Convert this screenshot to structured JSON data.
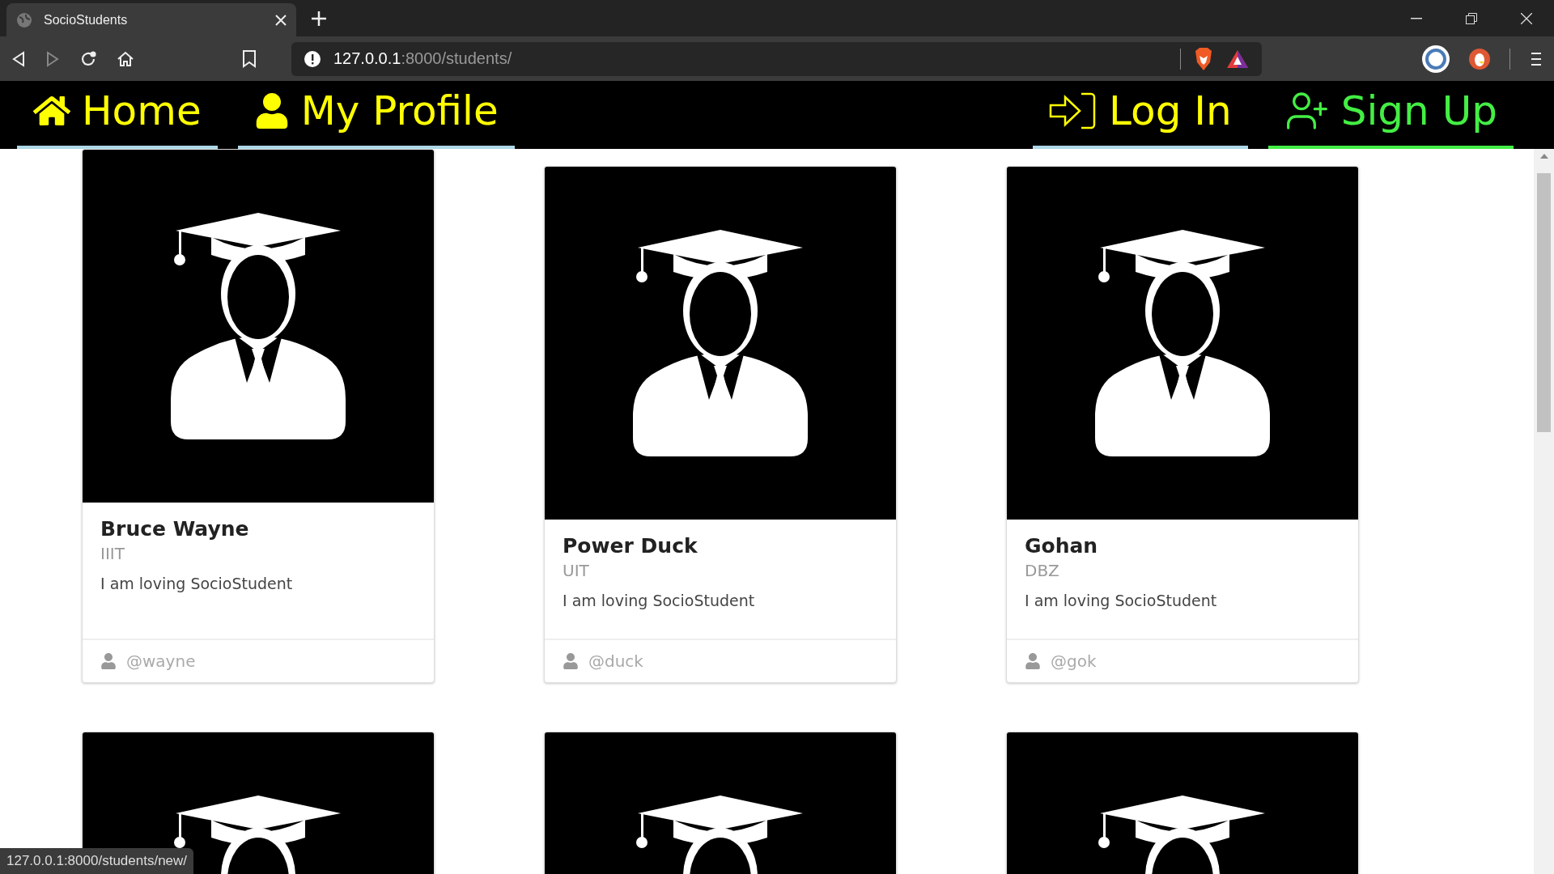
{
  "browser": {
    "tab_title": "SocioStudents",
    "url_host": "127.0.0.1",
    "url_path": ":8000/students/",
    "status_url": "127.0.0.1:8000/students/new/"
  },
  "nav": {
    "left": [
      {
        "label": "Home",
        "kind": "home",
        "color": "#ffff00"
      },
      {
        "label": "My Profile",
        "kind": "profile",
        "color": "#ffff00"
      }
    ],
    "right": [
      {
        "label": "Log In",
        "kind": "login",
        "color": "#ffff00"
      },
      {
        "label": "Sign Up",
        "kind": "signup",
        "color": "#44ee44"
      }
    ]
  },
  "cards": [
    {
      "kind": "full",
      "name": "Bruce Wayne",
      "institute": "IIIT",
      "bio": "I am loving SocioStudent",
      "username": "@wayne",
      "raised": true
    },
    {
      "kind": "full",
      "name": "Power Duck",
      "institute": "UIT",
      "bio": "I am loving SocioStudent",
      "username": "@duck",
      "raised": false
    },
    {
      "kind": "full",
      "name": "Gohan",
      "institute": "DBZ",
      "bio": "I am loving SocioStudent",
      "username": "@gok",
      "raised": false
    },
    {
      "kind": "partial",
      "raised": false
    },
    {
      "kind": "partial",
      "raised": false
    },
    {
      "kind": "partial",
      "raised": false
    }
  ]
}
